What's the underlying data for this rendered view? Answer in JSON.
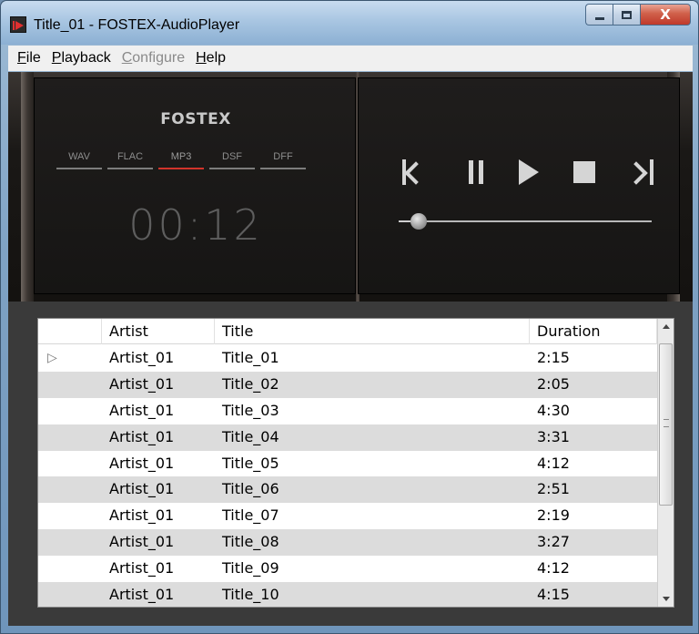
{
  "window": {
    "title": "Title_01 - FOSTEX-AudioPlayer",
    "close_label": "X"
  },
  "menu": [
    {
      "key": "F",
      "rest": "ile",
      "enabled": true
    },
    {
      "key": "P",
      "rest": "layback",
      "enabled": true
    },
    {
      "key": "C",
      "rest": "onfigure",
      "enabled": false
    },
    {
      "key": "H",
      "rest": "elp",
      "enabled": true
    }
  ],
  "player": {
    "brand": "FOSTEX",
    "formats": [
      "WAV",
      "FLAC",
      "MP3",
      "DSF",
      "DFF"
    ],
    "active_format": "MP3",
    "time": "00:12",
    "seek_fraction": 0.08
  },
  "playlist": {
    "columns": {
      "artist": "Artist",
      "title": "Title",
      "duration": "Duration"
    },
    "now_playing_index": 0,
    "rows": [
      {
        "artist": "Artist_01",
        "title": "Title_01",
        "duration": "2:15"
      },
      {
        "artist": "Artist_01",
        "title": "Title_02",
        "duration": "2:05"
      },
      {
        "artist": "Artist_01",
        "title": "Title_03",
        "duration": "4:30"
      },
      {
        "artist": "Artist_01",
        "title": "Title_04",
        "duration": "3:31"
      },
      {
        "artist": "Artist_01",
        "title": "Title_05",
        "duration": "4:12"
      },
      {
        "artist": "Artist_01",
        "title": "Title_06",
        "duration": "2:51"
      },
      {
        "artist": "Artist_01",
        "title": "Title_07",
        "duration": "2:19"
      },
      {
        "artist": "Artist_01",
        "title": "Title_08",
        "duration": "3:27"
      },
      {
        "artist": "Artist_01",
        "title": "Title_09",
        "duration": "4:12"
      },
      {
        "artist": "Artist_01",
        "title": "Title_10",
        "duration": "4:15"
      }
    ]
  }
}
